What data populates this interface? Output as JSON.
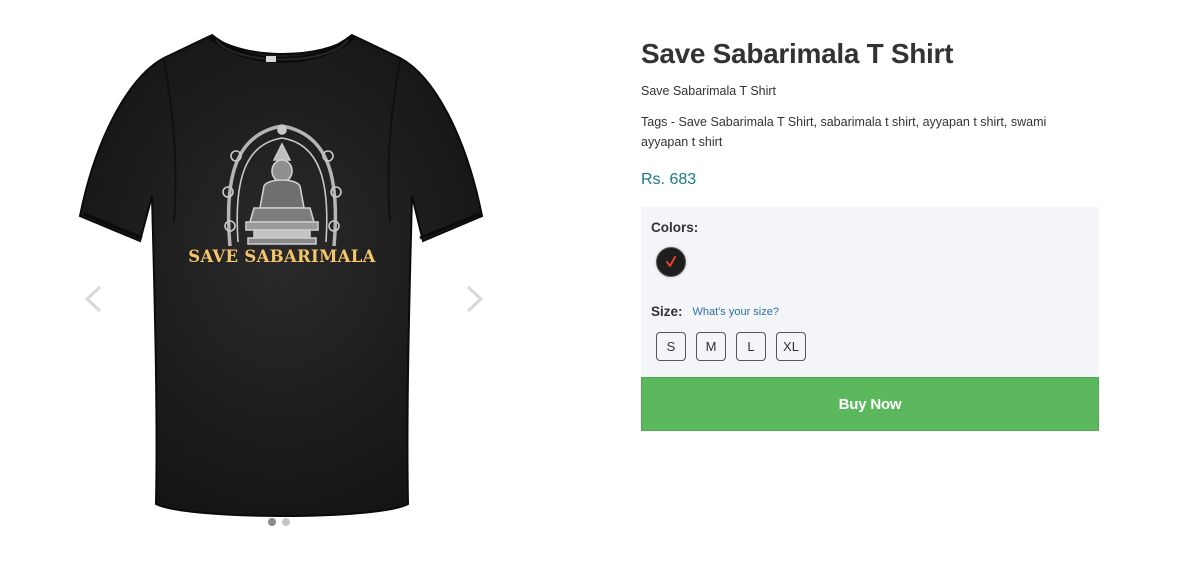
{
  "gallery": {
    "print_text": "SAVE SABARIMALA",
    "slide_count": 2,
    "active_slide": 1
  },
  "product": {
    "title": "Save Sabarimala T Shirt",
    "subtitle": "Save Sabarimala T Shirt",
    "tags": "Tags - Save Sabarimala T Shirt, sabarimala t shirt, ayyapan t shirt, swami ayyapan t shirt",
    "price": "Rs. 683"
  },
  "options": {
    "colors_label": "Colors:",
    "colors": [
      {
        "name": "black",
        "hex": "#1e1e1e",
        "selected": true,
        "check_color": "#e8412c"
      }
    ],
    "size_label": "Size:",
    "size_guide_link": "What's your size?",
    "sizes": [
      "S",
      "M",
      "L",
      "XL"
    ]
  },
  "actions": {
    "buy_label": "Buy Now"
  },
  "colors": {
    "accent_green": "#5cb85c",
    "price_teal": "#1a7a80",
    "link_blue": "#2f6fa8",
    "panel_bg": "#f4f5f9"
  }
}
